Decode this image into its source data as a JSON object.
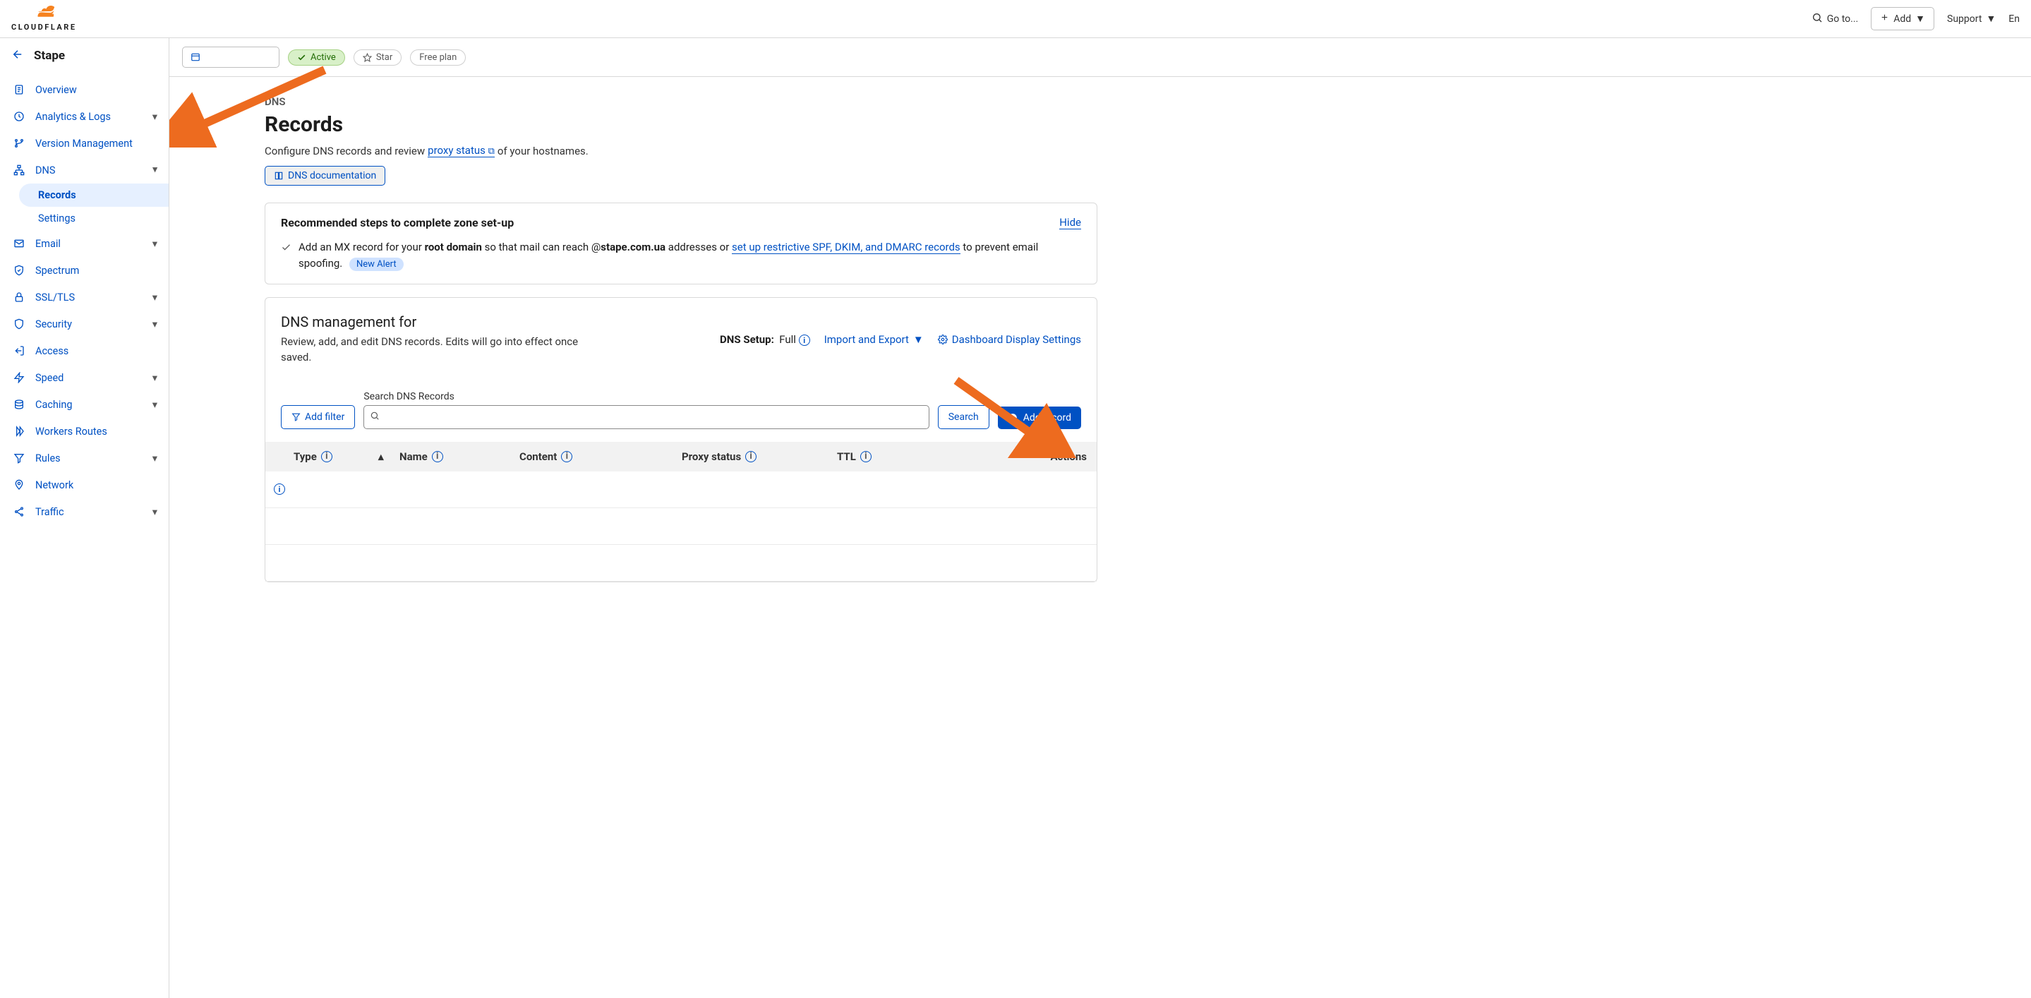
{
  "header": {
    "brand": "CLOUDFLARE",
    "goto": "Go to...",
    "add": "Add",
    "support": "Support",
    "lang_short": "En"
  },
  "site_name": "Stape",
  "nav": {
    "overview": "Overview",
    "analytics": "Analytics & Logs",
    "version": "Version Management",
    "dns": "DNS",
    "dns_records": "Records",
    "dns_settings": "Settings",
    "email": "Email",
    "spectrum": "Spectrum",
    "ssl": "SSL/TLS",
    "security": "Security",
    "access": "Access",
    "speed": "Speed",
    "caching": "Caching",
    "workers": "Workers Routes",
    "rules": "Rules",
    "network": "Network",
    "traffic": "Traffic"
  },
  "toolbar": {
    "status_active": "Active",
    "star": "Star",
    "plan": "Free plan"
  },
  "page": {
    "crumb": "DNS",
    "title": "Records",
    "desc_prefix": "Configure DNS records and review ",
    "desc_link": "proxy status",
    "desc_suffix": " of your hostnames.",
    "doc_button": "DNS documentation"
  },
  "rec": {
    "title": "Recommended steps to complete zone set-up",
    "hide": "Hide",
    "text_prefix": "Add an MX record for your ",
    "text_bold1": "root domain",
    "text_mid": " so that mail can reach @",
    "text_bold2": "stape.com.ua",
    "text_mid2": " addresses or ",
    "text_link": "set up restrictive SPF, DKIM, and DMARC records",
    "text_suffix": " to prevent email spoofing.",
    "new_alert": "New Alert"
  },
  "dns": {
    "title": "DNS management for",
    "desc": "Review, add, and edit DNS records. Edits will go into effect once saved.",
    "setup_label": "DNS Setup:",
    "setup_value": "Full",
    "import_export": "Import and Export",
    "display_settings": "Dashboard Display Settings",
    "add_filter": "Add filter",
    "search_label": "Search DNS Records",
    "search_btn": "Search",
    "add_record": "Add record"
  },
  "columns": {
    "type": "Type",
    "name": "Name",
    "content": "Content",
    "proxy": "Proxy status",
    "ttl": "TTL",
    "actions": "Actions"
  }
}
